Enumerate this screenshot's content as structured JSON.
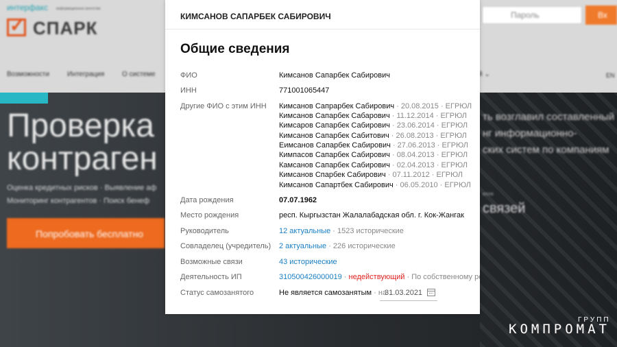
{
  "background": {
    "logo_small": "интерфакс",
    "logo_tagline": "информационное агентство",
    "logo_text": "СПАРК",
    "nav": [
      "Возможности",
      "Интеграция",
      "О системе"
    ],
    "nav_lang": "EN",
    "password_placeholder": "Пароль",
    "login_label": "Вх",
    "hero_line1": "Проверка",
    "hero_line2": "контраген",
    "hero_sub1": "Оценка кредитных рисков · Выявление аф",
    "hero_sub2": "Мониторинг контрагентов · Поиск бенеф",
    "try_button": "Попробовать бесплатно",
    "hero_right1": "ть возглавил составленный",
    "hero_right2": "нг информационно-",
    "hero_right3": "ских систем по компаниям",
    "hero_right4": "связей",
    "hero_right_small": "елля",
    "colors": {
      "accent": "#ed6a1f",
      "teal": "#27b7c5"
    }
  },
  "card": {
    "header": "КИМСАНОВ САПАРБЕК САБИРОВИЧ",
    "title": "Общие сведения",
    "fio_label": "ФИО",
    "fio_value": "Кимсанов Сапарбек Сабирович",
    "inn_label": "ИНН",
    "inn_value": "771001065447",
    "other_fio_label": "Другие ФИО с этим ИНН",
    "other_fio": [
      {
        "name": "Кимсанов Сапрарбек Сабирович",
        "meta": " · 20.08.2015 · ЕГРЮЛ"
      },
      {
        "name": "Кимсанов Сапарбек Сабарович",
        "meta": " · 11.12.2014 · ЕГРЮЛ"
      },
      {
        "name": "Кимсаров Сапарбек Сабирович",
        "meta": " · 23.06.2014 · ЕГРЮЛ"
      },
      {
        "name": "Кимсанов Сапарбек Сабитович",
        "meta": " · 26.08.2013 · ЕГРЮЛ"
      },
      {
        "name": "Еимсанов Сапарбек Сабирович",
        "meta": " · 27.06.2013 · ЕГРЮЛ"
      },
      {
        "name": "Кимпасов Сапарбек Сабирович",
        "meta": " · 08.04.2013 · ЕГРЮЛ"
      },
      {
        "name": "Камсанов Сапарбек Сабирович",
        "meta": " · 02.04.2013 · ЕГРЮЛ"
      },
      {
        "name": "Кимсанов Спарбек Сабирович",
        "meta": " · 07.11.2012 · ЕГРЮЛ"
      },
      {
        "name": "Кимсанов Сапартбек Сабирович",
        "meta": " · 06.05.2010 · ЕГРЮЛ"
      }
    ],
    "birth_date_label": "Дата рождения",
    "birth_date_value": "07.07.1962",
    "birth_place_label": "Место рождения",
    "birth_place_value": "респ. Кыргызстан Жалалабадская обл. г. Кок-Жангак",
    "head_label": "Руководитель",
    "head_current": "12 актуальные",
    "head_hist": " · 1523 исторические",
    "coowner_label": "Совладелец (учредитель)",
    "coowner_current": "2 актуальные",
    "coowner_hist": " · 226 исторические",
    "links_label": "Возможные связи",
    "links_value": "43 исторические",
    "ip_label": "Деятельность ИП",
    "ip_number": "310500426000019",
    "ip_sep": " · ",
    "ip_status": "недействующий",
    "ip_rest": " · По собственному реш",
    "selfemp_label": "Статус самозанятого",
    "selfemp_value": "Не является самозанятым",
    "selfemp_on": " · на",
    "selfemp_date": "31.03.2021"
  },
  "watermark": {
    "group": "ГРУПП",
    "main": "КОМПРОМАТ"
  }
}
